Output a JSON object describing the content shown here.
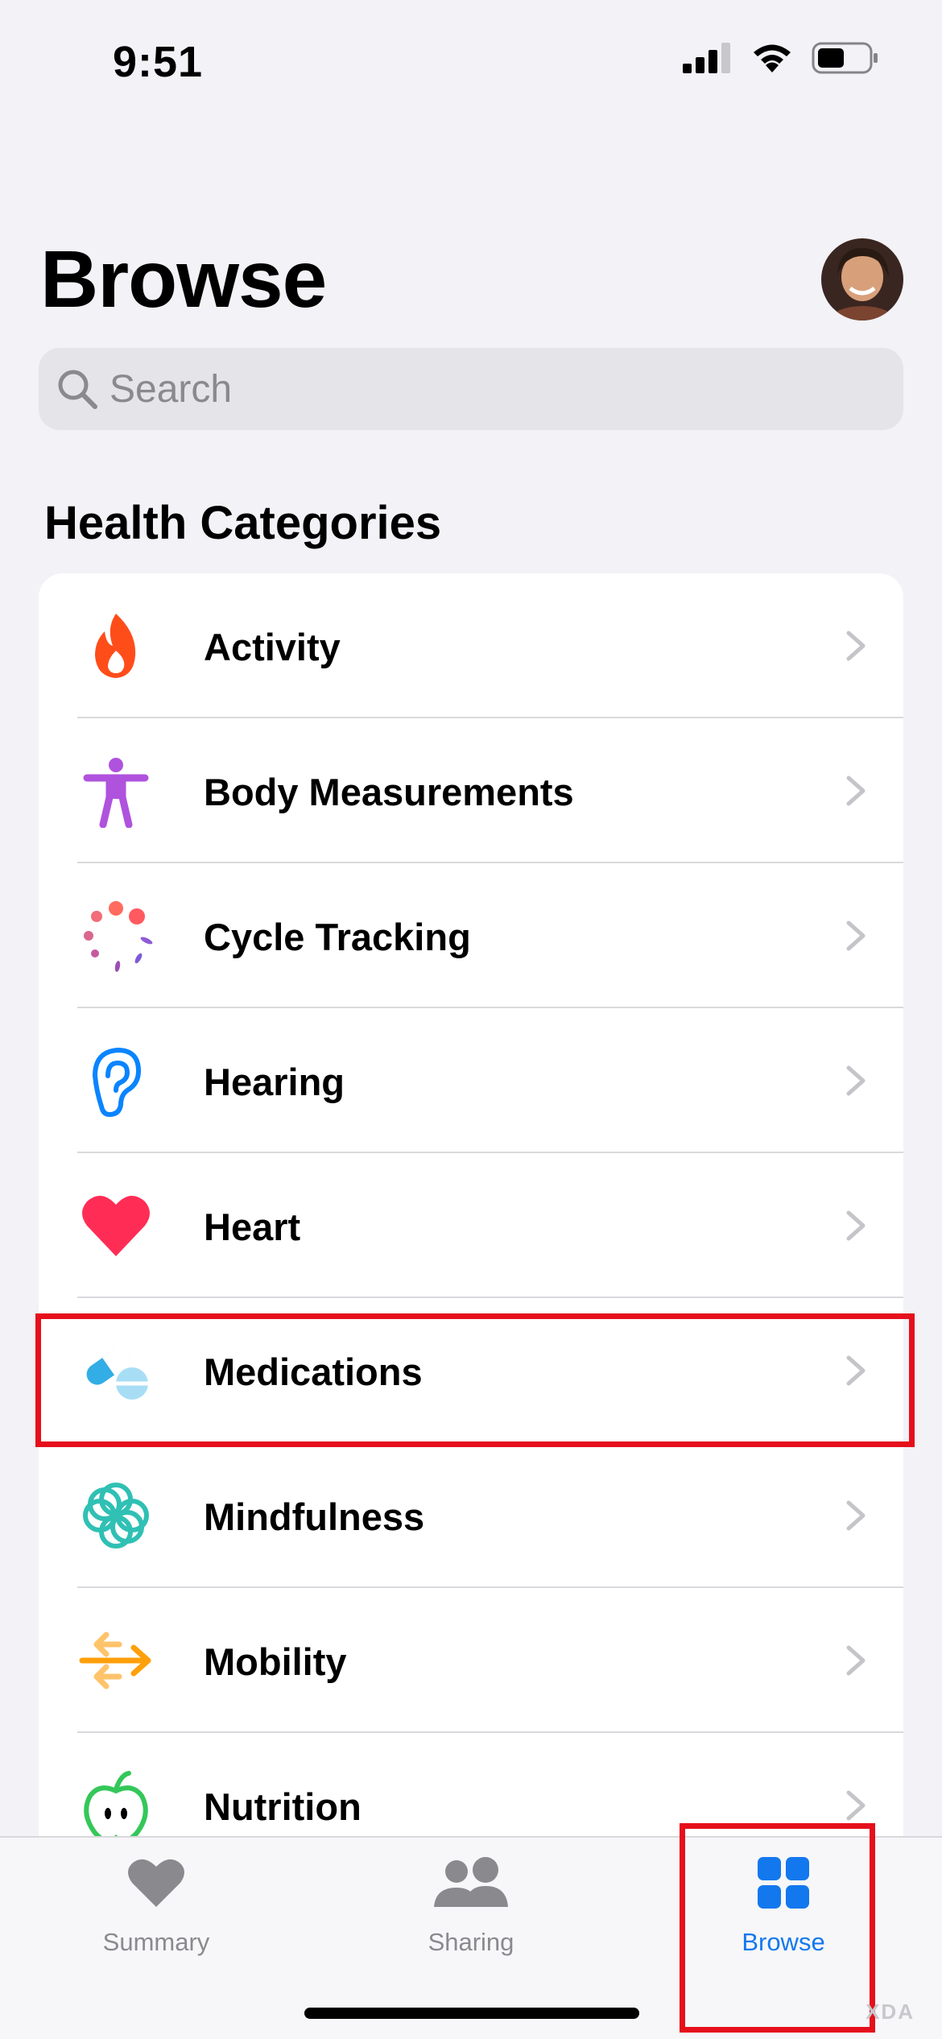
{
  "status_bar": {
    "time": "9:51"
  },
  "header": {
    "title": "Browse"
  },
  "search": {
    "placeholder": "Search"
  },
  "section": {
    "title": "Health Categories"
  },
  "categories": [
    {
      "label": "Activity",
      "icon": "flame-icon",
      "color": "#ff3b30"
    },
    {
      "label": "Body Measurements",
      "icon": "figure-icon",
      "color": "#af52de"
    },
    {
      "label": "Cycle Tracking",
      "icon": "cycle-dots-icon",
      "color": "#ff5f6d"
    },
    {
      "label": "Hearing",
      "icon": "ear-icon",
      "color": "#0a84ff"
    },
    {
      "label": "Heart",
      "icon": "heart-icon",
      "color": "#ff2d55"
    },
    {
      "label": "Medications",
      "icon": "pills-icon",
      "color": "#32ade6"
    },
    {
      "label": "Mindfulness",
      "icon": "flower-icon",
      "color": "#30c0b4"
    },
    {
      "label": "Mobility",
      "icon": "arrows-icon",
      "color": "#ff9f0a"
    },
    {
      "label": "Nutrition",
      "icon": "apple-icon",
      "color": "#34c759"
    }
  ],
  "tabbar": {
    "tabs": [
      {
        "label": "Summary",
        "icon": "heart-tab-icon",
        "active": false
      },
      {
        "label": "Sharing",
        "icon": "people-tab-icon",
        "active": false
      },
      {
        "label": "Browse",
        "icon": "grid-tab-icon",
        "active": true
      }
    ]
  },
  "colors": {
    "accent": "#1378ee",
    "highlight": "#e5101c"
  },
  "watermark": "XDA"
}
